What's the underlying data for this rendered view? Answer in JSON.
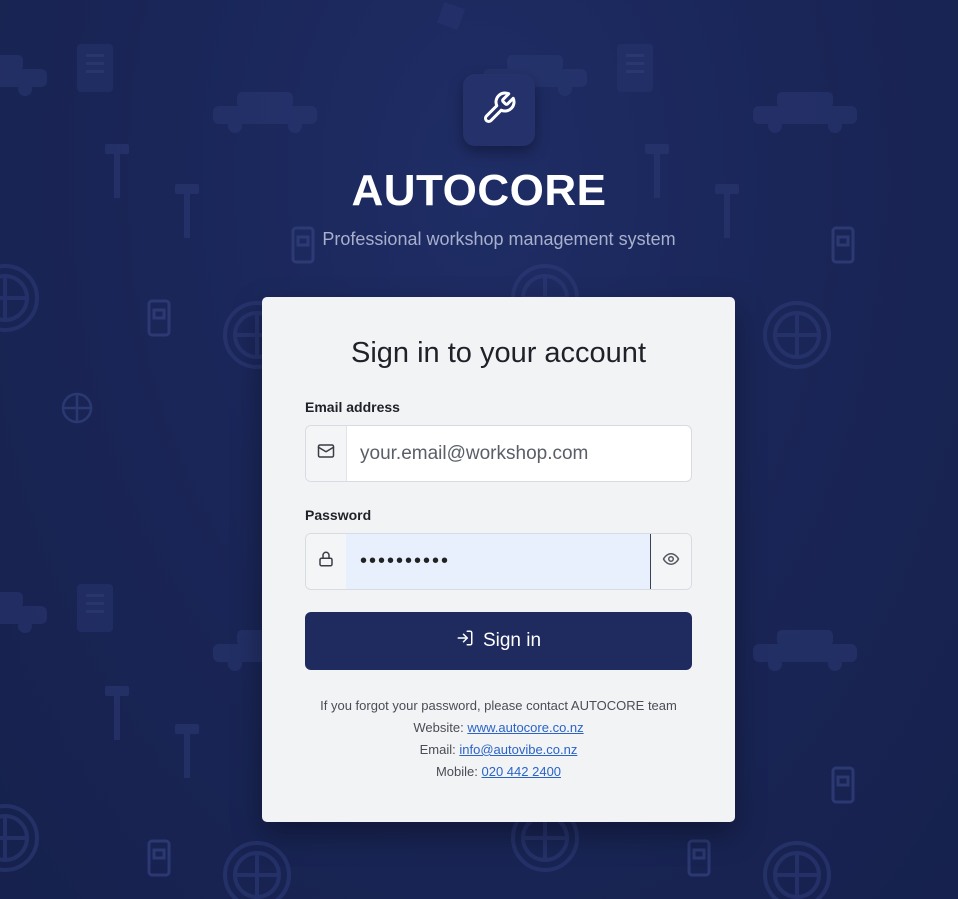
{
  "brand": {
    "title": "AUTOCORE",
    "subtitle": "Professional workshop management system",
    "logo_icon": "wrench-icon"
  },
  "login": {
    "heading": "Sign in to your account",
    "email": {
      "label": "Email address",
      "placeholder": "your.email@workshop.com",
      "value": "",
      "icon": "mail-icon"
    },
    "password": {
      "label": "Password",
      "value": "••••••••••",
      "icon": "lock-icon",
      "toggle_icon": "eye-icon"
    },
    "submit": {
      "label": "Sign in",
      "icon": "sign-in-icon"
    }
  },
  "help": {
    "forgot_text": "If you forgot your password, please contact AUTOCORE team",
    "website_label": "Website:",
    "website_link": "www.autocore.co.nz",
    "email_label": "Email:",
    "email_link": "info@autovibe.co.nz",
    "mobile_label": "Mobile:",
    "mobile_link": "020 442 2400"
  },
  "colors": {
    "background": "#1a2658",
    "card": "#f2f3f5",
    "primary_button": "#1f2a5e",
    "link": "#2a64c8"
  }
}
